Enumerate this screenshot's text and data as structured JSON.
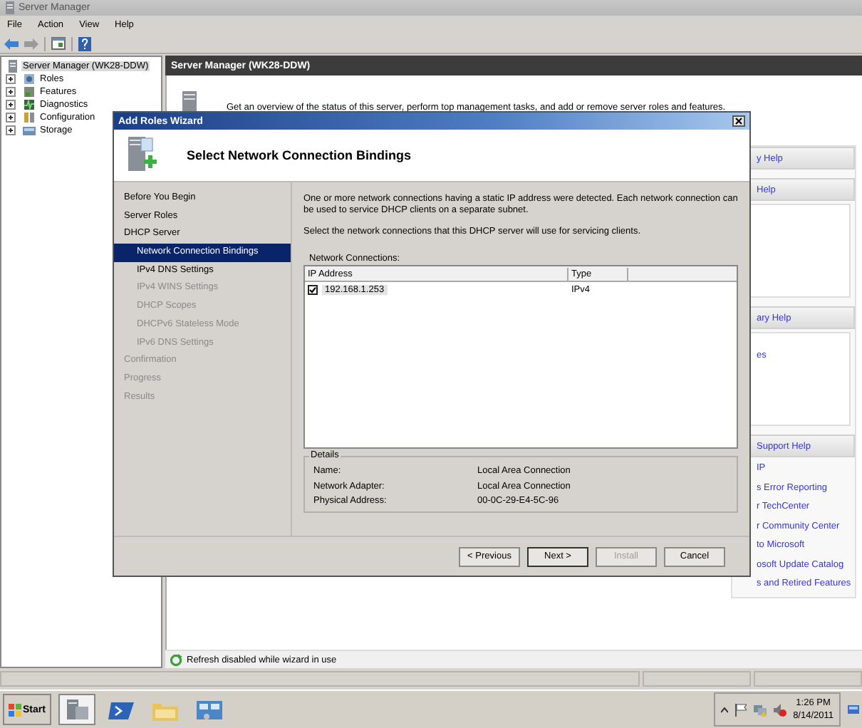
{
  "window": {
    "title": "Server Manager",
    "menu": [
      "File",
      "Action",
      "View",
      "Help"
    ]
  },
  "tree": {
    "items": [
      {
        "label": "Server Manager (WK28-DDW)",
        "selected": true,
        "kind": "server",
        "children": [
          {
            "label": "Roles",
            "selected": false,
            "expanded": false,
            "kind": "roles"
          },
          {
            "label": "Features",
            "selected": false,
            "expanded": false,
            "kind": "features"
          },
          {
            "label": "Diagnostics",
            "selected": false,
            "expanded": false,
            "kind": "diagnostics"
          },
          {
            "label": "Configuration",
            "selected": false,
            "expanded": false,
            "kind": "configuration"
          },
          {
            "label": "Storage",
            "selected": false,
            "expanded": false,
            "kind": "storage"
          }
        ]
      }
    ]
  },
  "main": {
    "header": "Server Manager (WK28-DDW)",
    "overview": "Get an overview of the status of this server, perform top management tasks, and add or remove server roles and features.",
    "side_sections": [
      {
        "header": "y Help",
        "box": false
      },
      {
        "header": "Help",
        "box": true
      },
      {
        "header": "ary Help",
        "box": true,
        "links": [
          "es"
        ]
      },
      {
        "header": "Support Help",
        "box": false,
        "links": [
          "IP",
          "s Error Reporting",
          "r TechCenter",
          "r Community Center",
          "to Microsoft",
          "osoft Update Catalog",
          "s and Retired Features"
        ]
      }
    ],
    "refresh_status": "Refresh disabled while wizard in use"
  },
  "wizard": {
    "title": "Add Roles Wizard",
    "heading": "Select Network Connection Bindings",
    "steps": [
      {
        "label": "Before You Begin",
        "selected": false,
        "disabled": false
      },
      {
        "label": "Server Roles",
        "selected": false,
        "disabled": false
      },
      {
        "label": "DHCP Server",
        "selected": false,
        "disabled": false,
        "children": [
          {
            "label": "Network Connection Bindings",
            "selected": true,
            "disabled": false
          },
          {
            "label": "IPv4 DNS Settings",
            "selected": false,
            "disabled": false
          },
          {
            "label": "IPv4 WINS Settings",
            "selected": false,
            "disabled": true
          },
          {
            "label": "DHCP Scopes",
            "selected": false,
            "disabled": true
          },
          {
            "label": "DHCPv6 Stateless Mode",
            "selected": false,
            "disabled": true
          },
          {
            "label": "IPv6 DNS Settings",
            "selected": false,
            "disabled": true
          }
        ]
      },
      {
        "label": "Confirmation",
        "selected": false,
        "disabled": true
      },
      {
        "label": "Progress",
        "selected": false,
        "disabled": true
      },
      {
        "label": "Results",
        "selected": false,
        "disabled": true
      }
    ],
    "intro": "One or more network connections having a static IP address were detected. Each network connection can be used to service DHCP clients on a separate subnet.",
    "instruction": "Select the network connections that this DHCP server will use for servicing clients.",
    "connections_label": "Network Connections:",
    "columns": [
      "IP Address",
      "Type"
    ],
    "rows": [
      {
        "checked": true,
        "selected": true,
        "ip": "192.168.1.253",
        "type": "IPv4"
      }
    ],
    "details": {
      "title": "Details",
      "fields": [
        {
          "label": "Name:",
          "value": "Local Area Connection"
        },
        {
          "label": "Network Adapter:",
          "value": "Local Area Connection"
        },
        {
          "label": "Physical Address:",
          "value": "00-0C-29-E4-5C-96"
        }
      ]
    },
    "buttons": [
      {
        "label": "< Previous",
        "disabled": false,
        "default": false
      },
      {
        "label": "Next >",
        "disabled": false,
        "default": true
      },
      {
        "label": "Install",
        "disabled": true,
        "default": false
      },
      {
        "label": "Cancel",
        "disabled": false,
        "default": false
      }
    ]
  },
  "taskbar": {
    "start": "Start",
    "apps": [
      {
        "kind": "server",
        "selected": true
      },
      {
        "kind": "powershell",
        "selected": false
      },
      {
        "kind": "explorer",
        "selected": false
      },
      {
        "kind": "control",
        "selected": false
      }
    ],
    "time": "1:26 PM",
    "date": "8/14/2011"
  }
}
